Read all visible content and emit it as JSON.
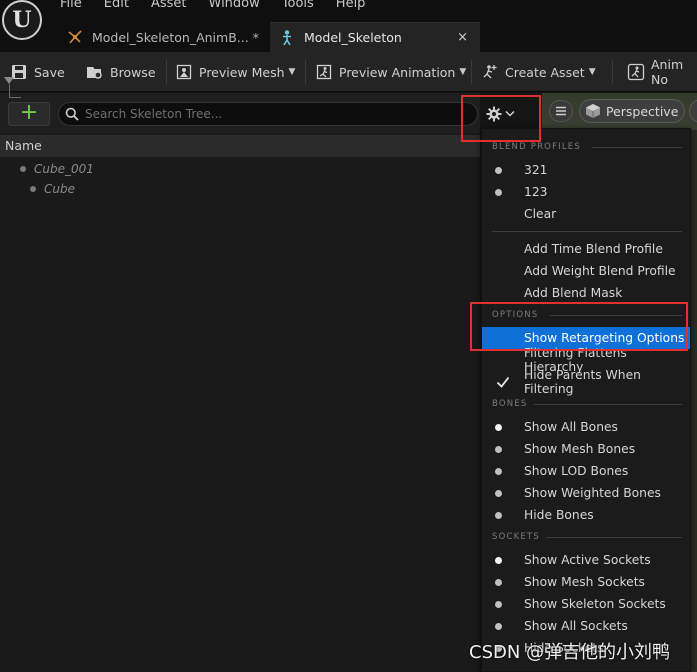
{
  "menu": [
    "File",
    "Edit",
    "Asset",
    "Window",
    "Tools",
    "Help"
  ],
  "tabs": [
    {
      "label": "Model_Skeleton_AnimB...",
      "modified": "*"
    },
    {
      "label": "Model_Skeleton",
      "close": "×"
    }
  ],
  "toolbar": {
    "save": "Save",
    "browse": "Browse",
    "preview_mesh": "Preview Mesh",
    "preview_animation": "Preview Animation",
    "create_asset": "Create Asset",
    "anim_notify": "Anim No"
  },
  "tree": {
    "add_label": "+",
    "search_placeholder": "Search Skeleton Tree...",
    "column_name": "Name",
    "bones": [
      "Cube_001",
      "Cube"
    ]
  },
  "viewport": {
    "perspective": "Perspective"
  },
  "dropdown": {
    "blend_profiles_header": "BLEND PROFILES",
    "blend_profiles": [
      "321",
      "123"
    ],
    "clear": "Clear",
    "add_items": [
      "Add Time Blend Profile",
      "Add Weight Blend Profile",
      "Add Blend Mask"
    ],
    "options_header": "OPTIONS",
    "options": [
      "Show Retargeting Options",
      "Filtering Flattens Hierarchy",
      "Hide Parents When Filtering"
    ],
    "bones_header": "BONES",
    "bones": [
      "Show All Bones",
      "Show Mesh Bones",
      "Show LOD Bones",
      "Show Weighted Bones",
      "Hide Bones"
    ],
    "sockets_header": "SOCKETS",
    "sockets": [
      "Show Active Sockets",
      "Show Mesh Sockets",
      "Show Skeleton Sockets",
      "Show All Sockets",
      "Hide Sockets"
    ]
  },
  "watermark": "CSDN @弹吉他的小刘鸭",
  "colors": {
    "accent": "#0f70d8",
    "highlight_box": "#e03030",
    "add_green": "#6fcf4c"
  }
}
